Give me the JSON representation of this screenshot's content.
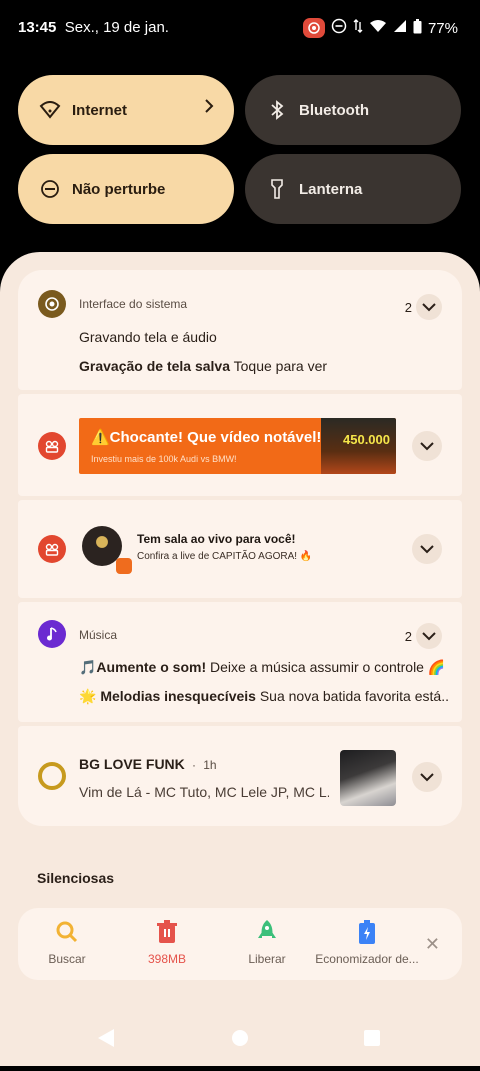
{
  "status_bar": {
    "time": "13:45",
    "date": "Sex., 19 de jan.",
    "battery": "77%"
  },
  "quick_tiles": [
    {
      "label": "Internet",
      "state": "on"
    },
    {
      "label": "Bluetooth",
      "state": "off"
    },
    {
      "label": "Não perturbe",
      "state": "on"
    },
    {
      "label": "Lanterna",
      "state": "off"
    }
  ],
  "notifications": {
    "system": {
      "app": "Interface do sistema",
      "count": "2",
      "line1": "Gravando tela e áudio",
      "line2_title": "Gravação de tela salva",
      "line2_text": "Toque para ver"
    },
    "promo": {
      "title": "⚠️Chocante! Que vídeo notável!",
      "subtitle": "Investiu mais de 100k Audi vs BMW!",
      "number": "450.000"
    },
    "live": {
      "title": "Tem sala ao vivo para você!",
      "subtitle": "Confira a live de CAPITÃO AGORA! 🔥"
    },
    "music": {
      "app": "Música",
      "count": "2",
      "line1_title": "🎵Aumente o som!",
      "line1_text": "Deixe a música assumir o controle 🌈",
      "line2_title": "🌟 Melodias inesquecíveis",
      "line2_text": "Sua nova batida favorita está..."
    },
    "media": {
      "title": "BG LOVE FUNK",
      "time": "1h",
      "text": "Vim de Lá - MC Tuto, MC Lele JP, MC L..."
    }
  },
  "section_label": "Silenciosas",
  "tools": [
    {
      "label": "Buscar",
      "color": "#f2b233"
    },
    {
      "label": "398MB",
      "color": "#e5534b"
    },
    {
      "label": "Liberar",
      "color": "#3cbf7a"
    },
    {
      "label": "Economizador de...",
      "color": "#3b82f6"
    }
  ],
  "colors": {
    "tile_on": "#f8d9a6",
    "tile_off": "#3a3430",
    "sheet": "#f7e9de",
    "card": "#fdf3ec"
  }
}
